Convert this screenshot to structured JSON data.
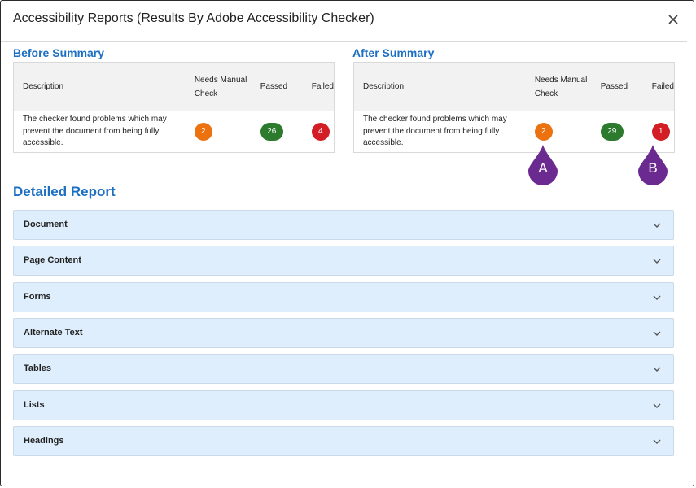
{
  "dialog": {
    "title": "Accessibility Reports (Results By Adobe Accessibility Checker)",
    "close_icon": "close-icon"
  },
  "before_summary": {
    "title": "Before Summary",
    "columns": [
      "Description",
      "Needs Manual Check",
      "Passed",
      "Failed"
    ],
    "description": "The checker found problems which may prevent the document from being fully accessible.",
    "needs_manual_check": "2",
    "passed": "26",
    "failed": "4"
  },
  "after_summary": {
    "title": "After Summary",
    "columns": [
      "Description",
      "Needs Manual Check",
      "Passed",
      "Failed"
    ],
    "description": "The checker found problems which may prevent the document from being fully accessible.",
    "needs_manual_check": "2",
    "passed": "29",
    "failed": "1"
  },
  "markers": {
    "a": "A",
    "b": "B"
  },
  "detailed_report": {
    "title": "Detailed Report",
    "sections": [
      "Document",
      "Page Content",
      "Forms",
      "Alternate Text",
      "Tables",
      "Lists",
      "Headings"
    ]
  },
  "colors": {
    "accent": "#1c6fc3",
    "badge_orange": "#ec7210",
    "badge_green": "#2b7a2e",
    "badge_red": "#d21e24",
    "marker_purple": "#6b2a8f",
    "accordion_bg": "#dfeefc"
  }
}
